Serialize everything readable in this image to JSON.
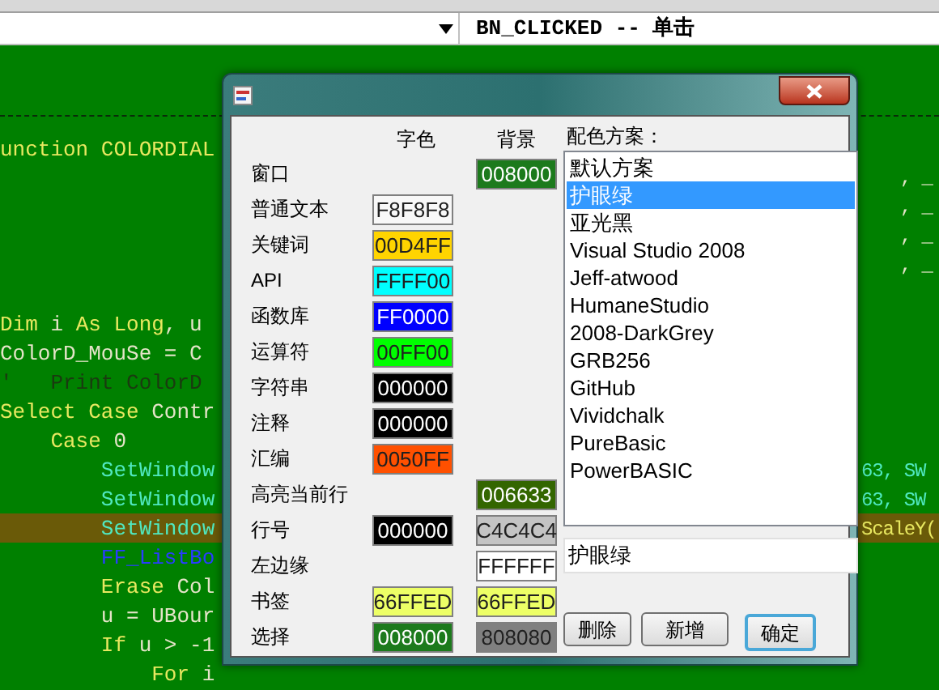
{
  "toolbar": {
    "event_field": "BN_CLICKED -- 单击"
  },
  "editor": {
    "lines": [
      {
        "kind": "code",
        "segments": [
          {
            "text": "unction COLORDIAL",
            "kind": "keyword"
          }
        ]
      },
      {
        "kind": "code",
        "right": {
          "text": ", _",
          "kind": "plain"
        }
      },
      {
        "kind": "code",
        "right": {
          "text": ", _",
          "kind": "plain"
        }
      },
      {
        "kind": "code",
        "right": {
          "text": ", _",
          "kind": "plain"
        }
      },
      {
        "kind": "code",
        "right": {
          "text": ", _",
          "kind": "plain"
        }
      },
      {
        "kind": "blank"
      },
      {
        "kind": "code",
        "segments": [
          {
            "text": "Dim",
            "kind": "keyword"
          },
          {
            "text": " i ",
            "kind": "plain"
          },
          {
            "text": "As Long",
            "kind": "keyword"
          },
          {
            "text": ", u",
            "kind": "plain"
          }
        ]
      },
      {
        "kind": "code",
        "segments": [
          {
            "text": "ColorD_MouSe = C",
            "kind": "plain"
          }
        ]
      },
      {
        "kind": "code",
        "segments": [
          {
            "text": "'   Print ColorD",
            "kind": "comment"
          }
        ]
      },
      {
        "kind": "code",
        "segments": [
          {
            "text": "Select Case",
            "kind": "keyword"
          },
          {
            "text": " Contr",
            "kind": "plain"
          }
        ]
      },
      {
        "kind": "code",
        "segments": [
          {
            "text": "    Case",
            "kind": "keyword"
          },
          {
            "text": " 0",
            "kind": "plain"
          }
        ]
      },
      {
        "kind": "code",
        "segments": [
          {
            "text": "        SetWindow",
            "kind": "func"
          }
        ],
        "right": {
          "text": "63, SW",
          "kind": "func"
        }
      },
      {
        "kind": "code",
        "segments": [
          {
            "text": "        SetWindow",
            "kind": "func"
          }
        ],
        "right": {
          "text": "63, SW",
          "kind": "func"
        }
      },
      {
        "kind": "code",
        "highlighted": true,
        "segments": [
          {
            "text": "        SetWindow",
            "kind": "func"
          }
        ],
        "right": {
          "text": "ScaleY(",
          "kind": "keyword"
        }
      },
      {
        "kind": "code",
        "segments": [
          {
            "text": "        FF_ListBo",
            "kind": "user"
          }
        ]
      },
      {
        "kind": "code",
        "segments": [
          {
            "text": "        Erase",
            "kind": "keyword"
          },
          {
            "text": " Col",
            "kind": "plain"
          }
        ]
      },
      {
        "kind": "code",
        "segments": [
          {
            "text": "        u = UBour",
            "kind": "plain"
          }
        ]
      },
      {
        "kind": "code",
        "segments": [
          {
            "text": "        If",
            "kind": "keyword"
          },
          {
            "text": " u > -1",
            "kind": "plain"
          }
        ]
      },
      {
        "kind": "code",
        "segments": [
          {
            "text": "            For",
            "kind": "keyword"
          },
          {
            "text": " i",
            "kind": "plain"
          }
        ]
      }
    ]
  },
  "dialog": {
    "headers": {
      "fore": "字色",
      "back": "背景"
    },
    "rows": [
      {
        "label": "窗口",
        "back": {
          "text": "008000",
          "color": "#1c7a1c"
        }
      },
      {
        "label": "普通文本",
        "fore": {
          "text": "F8F8F8",
          "color": "#f8f8f8"
        }
      },
      {
        "label": "关键词",
        "fore": {
          "text": "00D4FF",
          "color": "#ffd400"
        }
      },
      {
        "label": "API",
        "fore": {
          "text": "FFFF00",
          "color": "#00ffff"
        }
      },
      {
        "label": "函数库",
        "fore": {
          "text": "FF0000",
          "color": "#0000ff"
        }
      },
      {
        "label": "运算符",
        "fore": {
          "text": "00FF00",
          "color": "#00ff00"
        }
      },
      {
        "label": "字符串",
        "fore": {
          "text": "000000",
          "color": "#000000"
        }
      },
      {
        "label": "注释",
        "fore": {
          "text": "000000",
          "color": "#000000"
        }
      },
      {
        "label": "汇编",
        "fore": {
          "text": "0050FF",
          "color": "#ff5000"
        }
      },
      {
        "label": "高亮当前行",
        "back": {
          "text": "006633",
          "color": "#336600"
        }
      },
      {
        "label": "行号",
        "fore": {
          "text": "000000",
          "color": "#000000"
        },
        "back": {
          "text": "C4C4C4",
          "color": "#c4c4c4"
        }
      },
      {
        "label": "左边缘",
        "back": {
          "text": "FFFFFF",
          "color": "#ffffff"
        }
      },
      {
        "label": "书签",
        "fore": {
          "text": "66FFED",
          "color": "#edff66"
        },
        "back": {
          "text": "66FFED",
          "color": "#edff66"
        }
      },
      {
        "label": "选择",
        "fore": {
          "text": "008000",
          "color": "#1c7a1c"
        },
        "back": {
          "text": "808080",
          "color": "#808080"
        }
      }
    ],
    "schemes_label": "配色方案：",
    "schemes": [
      {
        "label": "默认方案",
        "selected": false
      },
      {
        "label": "护眼绿",
        "selected": true
      },
      {
        "label": "亚光黑",
        "selected": false
      },
      {
        "label": "Visual Studio 2008",
        "selected": false
      },
      {
        "label": "Jeff-atwood",
        "selected": false
      },
      {
        "label": "HumaneStudio",
        "selected": false
      },
      {
        "label": "2008-DarkGrey",
        "selected": false
      },
      {
        "label": "GRB256",
        "selected": false
      },
      {
        "label": "GitHub",
        "selected": false
      },
      {
        "label": "Vividchalk",
        "selected": false
      },
      {
        "label": "PureBasic",
        "selected": false
      },
      {
        "label": "PowerBASIC",
        "selected": false
      }
    ],
    "scheme_name": "护眼绿",
    "buttons": [
      {
        "label": "删除",
        "default": false
      },
      {
        "label": "新增",
        "default": false
      },
      {
        "label": "确定",
        "default": true
      }
    ]
  }
}
